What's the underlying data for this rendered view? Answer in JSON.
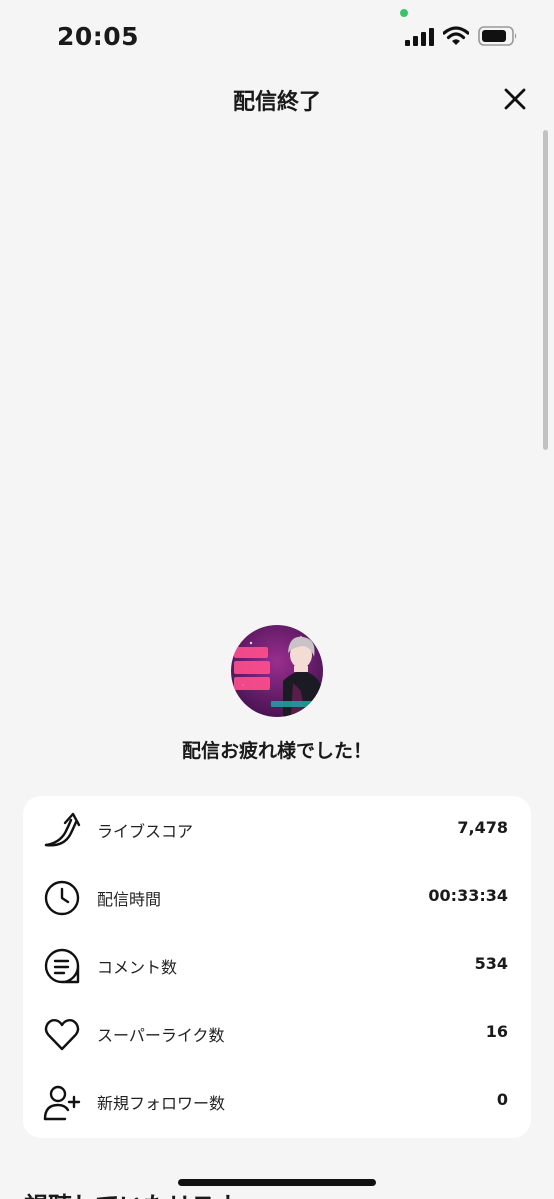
{
  "status_bar": {
    "time": "20:05",
    "indicator_color": "#39c36d"
  },
  "header": {
    "title": "配信終了",
    "close_icon": "close-icon"
  },
  "profile": {
    "avatar_icon": "streamer-avatar",
    "thanks_message": "配信お疲れ様でした！"
  },
  "stats": [
    {
      "icon": "rising-arrow-icon",
      "label": "ライブスコア",
      "value": "7,478"
    },
    {
      "icon": "clock-icon",
      "label": "配信時間",
      "value": "00:33:34"
    },
    {
      "icon": "comment-icon",
      "label": "コメント数",
      "value": "534"
    },
    {
      "icon": "heart-icon",
      "label": "スーパーライク数",
      "value": "16"
    },
    {
      "icon": "add-user-icon",
      "label": "新規フォロワー数",
      "value": "0"
    }
  ],
  "next_section": {
    "heading": "視聴していたリスナー"
  },
  "colors": {
    "background": "#f5f5f5",
    "card": "#ffffff",
    "avatar_bg": "#6b1c6e"
  }
}
